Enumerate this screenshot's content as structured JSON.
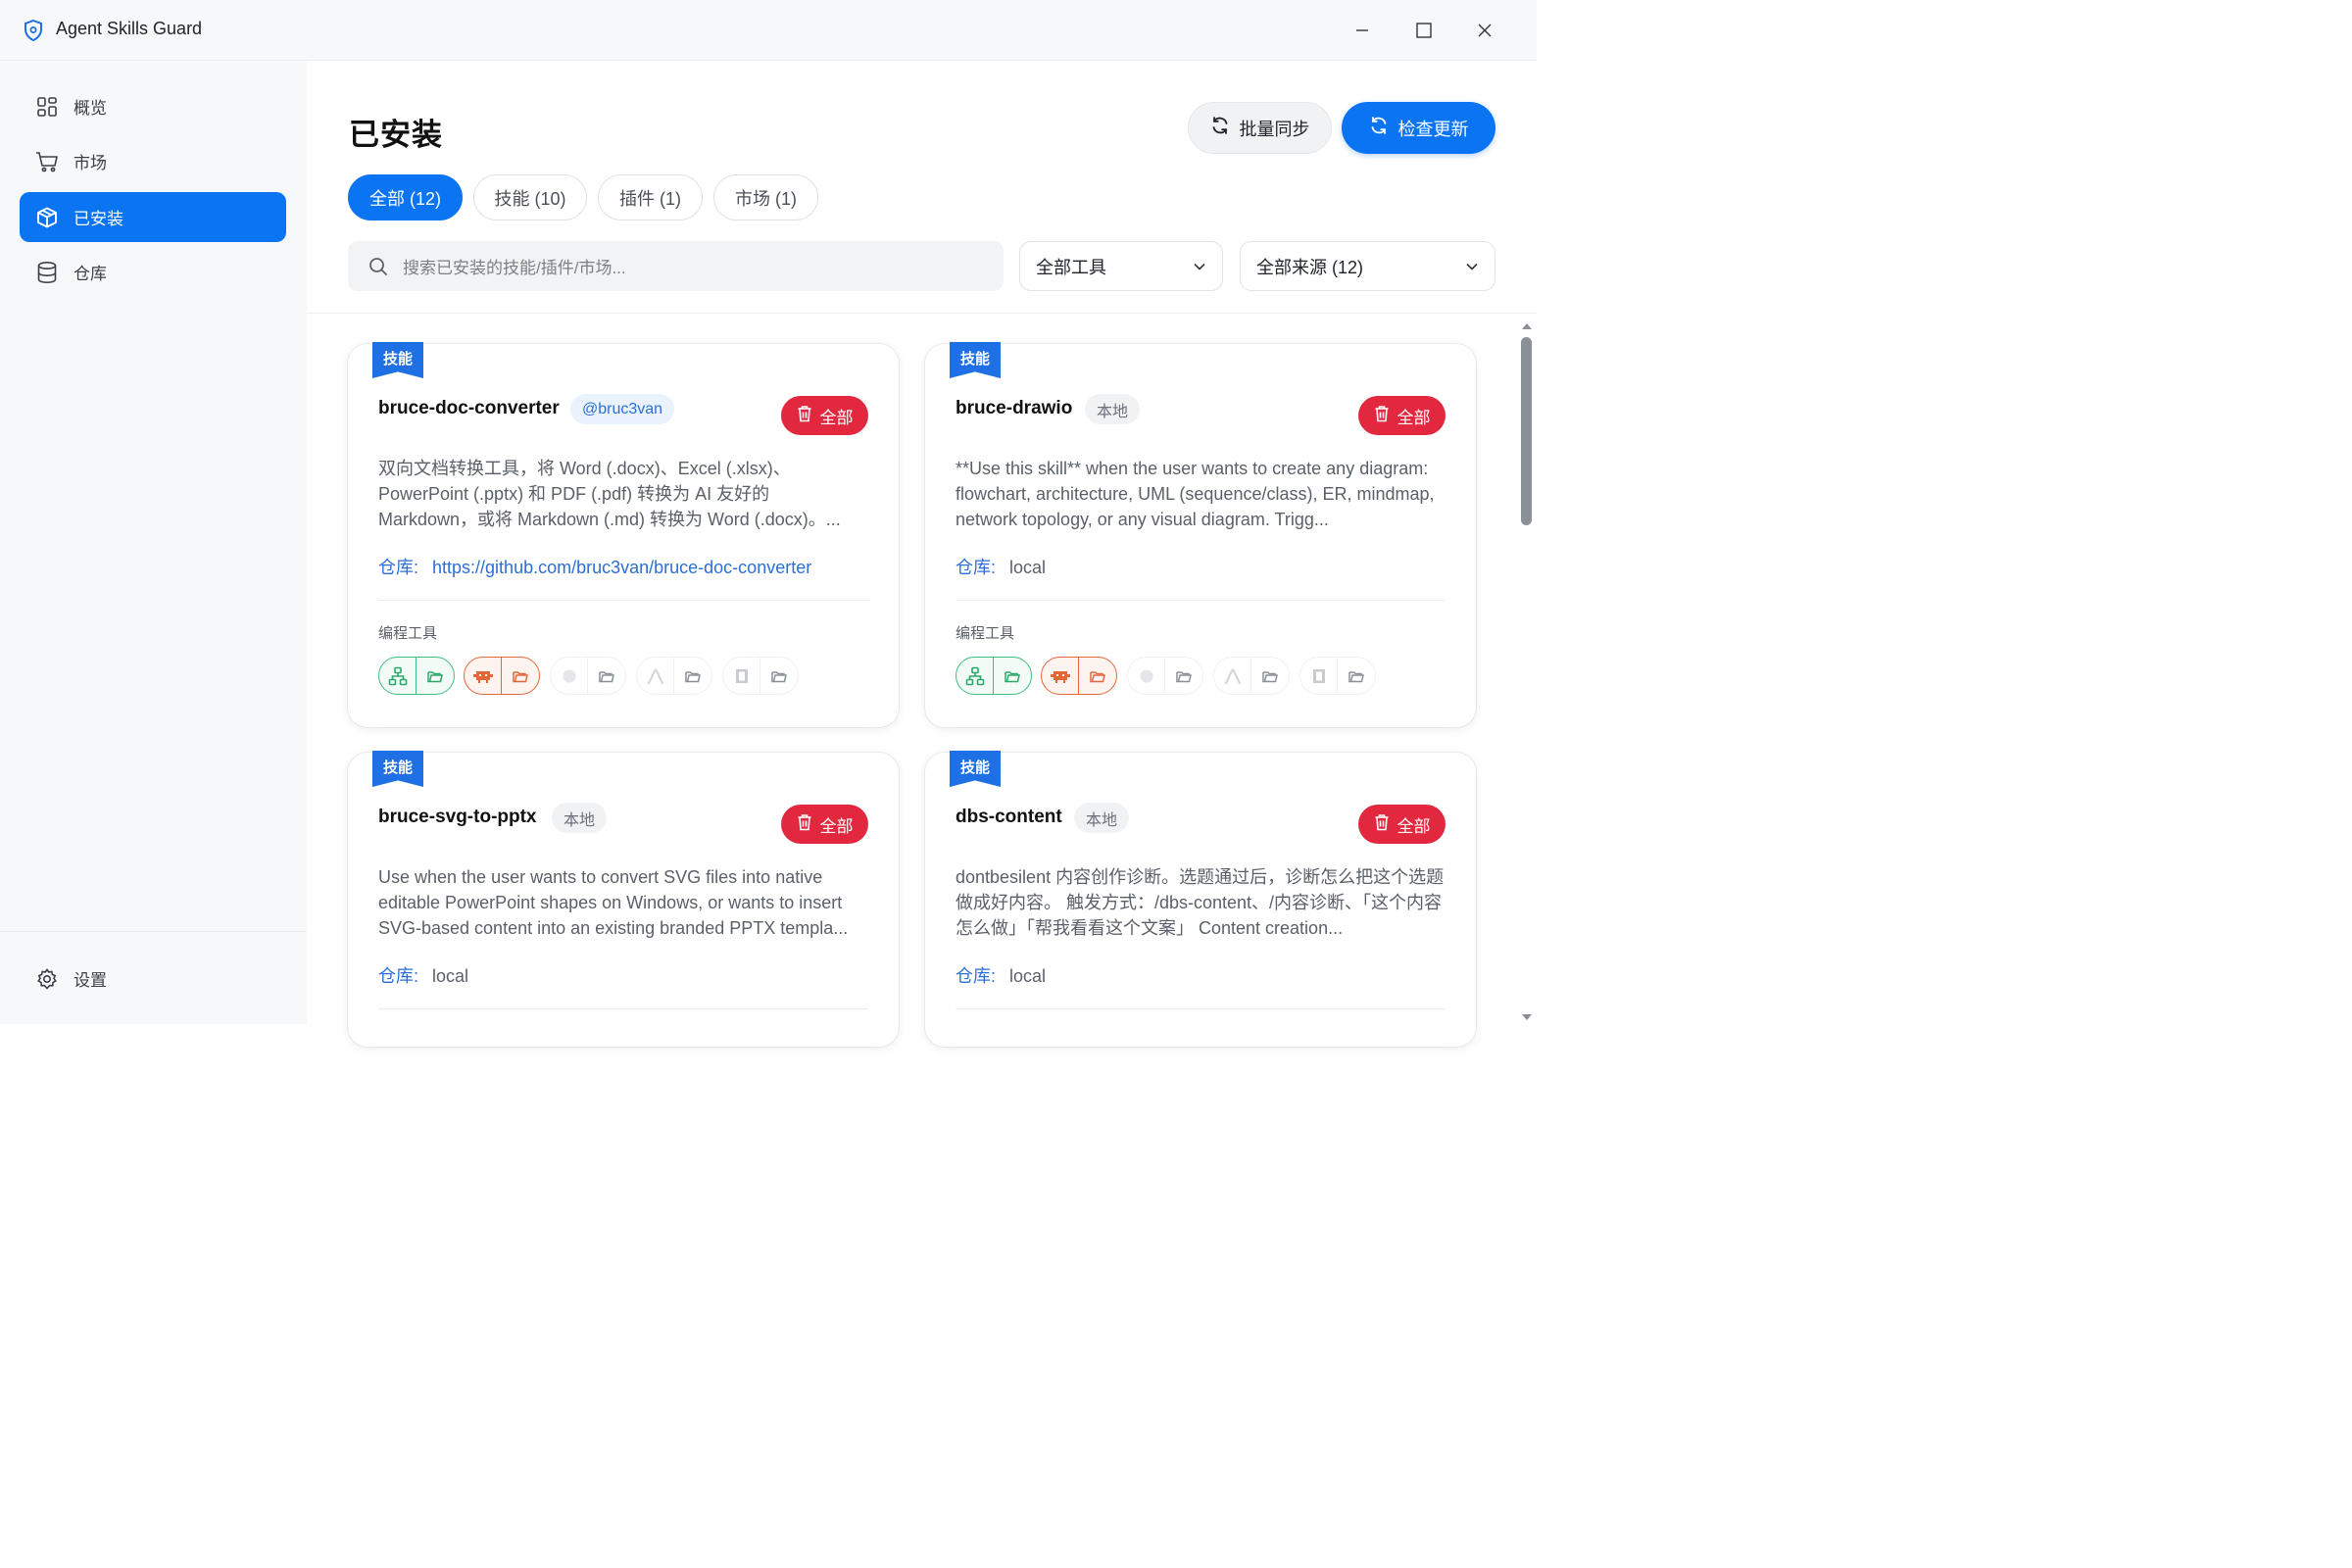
{
  "app": {
    "title": "Agent Skills Guard"
  },
  "sidebar": {
    "items": [
      {
        "label": "概览",
        "icon": "dashboard-icon"
      },
      {
        "label": "市场",
        "icon": "cart-icon"
      },
      {
        "label": "已安装",
        "icon": "box-icon",
        "active": true
      },
      {
        "label": "仓库",
        "icon": "database-icon"
      }
    ],
    "settings": {
      "label": "设置",
      "icon": "gear-icon"
    }
  },
  "header": {
    "title": "已安装",
    "sync_label": "批量同步",
    "check_label": "检查更新"
  },
  "tabs": [
    {
      "label": "全部 (12)",
      "active": true
    },
    {
      "label": "技能 (10)"
    },
    {
      "label": "插件 (1)"
    },
    {
      "label": "市场 (1)"
    }
  ],
  "search": {
    "placeholder": "搜索已安装的技能/插件/市场..."
  },
  "filters": {
    "tool": "全部工具",
    "source": "全部来源 (12)"
  },
  "cards": [
    {
      "type": "技能",
      "name": "bruce-doc-converter",
      "source": "@bruc3van",
      "source_kind": "user",
      "delete_label": "全部",
      "description": "双向文档转换工具，将 Word (.docx)、Excel (.xlsx)、PowerPoint (.pptx) 和 PDF (.pdf) 转换为 AI 友好的 Markdown，或将 Markdown (.md) 转换为 Word (.docx)。...",
      "repo_label": "仓库:",
      "repo_value": "https://github.com/bruc3van/bruce-doc-converter",
      "tools_label": "编程工具"
    },
    {
      "type": "技能",
      "name": "bruce-drawio",
      "source": "本地",
      "source_kind": "local",
      "delete_label": "全部",
      "description": "**Use this skill** when the user wants to create any diagram: flowchart, architecture, UML (sequence/class), ER, mindmap, network topology, or any visual diagram. Trigg...",
      "repo_label": "仓库:",
      "repo_value": "local",
      "tools_label": "编程工具"
    },
    {
      "type": "技能",
      "name": "bruce-svg-to-pptx",
      "source": "本地",
      "source_kind": "local",
      "delete_label": "全部",
      "description": "Use when the user wants to convert SVG files into native editable PowerPoint shapes on Windows, or wants to insert SVG-based content into an existing branded PPTX templa...",
      "repo_label": "仓库:",
      "repo_value": "local",
      "tools_label": ""
    },
    {
      "type": "技能",
      "name": "dbs-content",
      "source": "本地",
      "source_kind": "local",
      "delete_label": "全部",
      "description": "dontbesilent 内容创作诊断。选题通过后，诊断怎么把这个选题做成好内容。 触发方式：/dbs-content、/内容诊断、「这个内容怎么做」「帮我看看这个文案」 Content creation...",
      "repo_label": "仓库:",
      "repo_value": "local",
      "tools_label": ""
    }
  ],
  "colors": {
    "accent": "#0a74f2",
    "danger": "#e2283f",
    "ribbon": "#1f6fe5",
    "tool_green": "#3fbf7f",
    "tool_orange": "#e4673a"
  }
}
